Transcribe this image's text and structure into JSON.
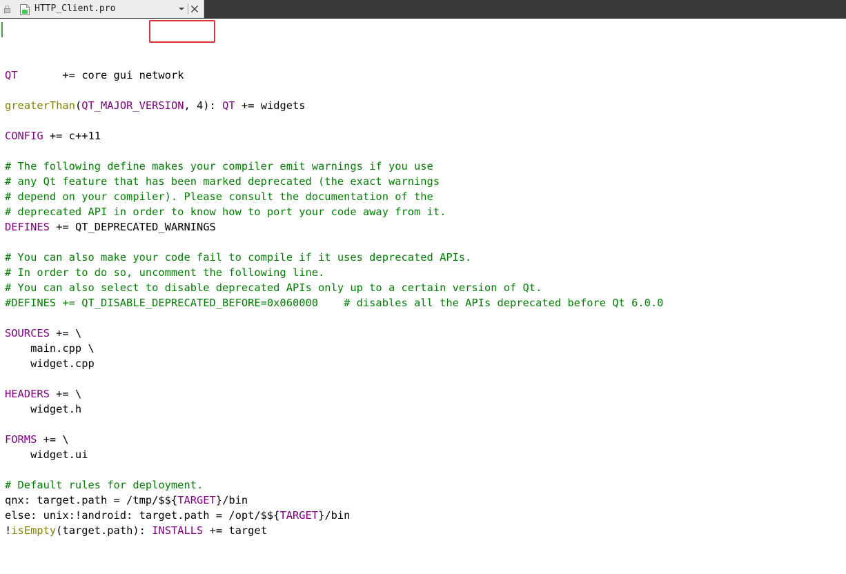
{
  "tab": {
    "title": "HTTP_Client.pro",
    "file_icon": "qt-project-file-icon",
    "lock_icon": "lock-icon",
    "dropdown_icon": "chevron-down-icon",
    "close_icon": "close-icon"
  },
  "colors": {
    "keyword": "#800080",
    "function": "#808000",
    "comment": "#008000",
    "highlight_box": "#e03030",
    "tabbar_bg": "#3a3a3a"
  },
  "editor": {
    "lines": [
      [
        {
          "t": "QT",
          "c": "kw"
        },
        {
          "t": "       += core gui ",
          "c": "pl"
        },
        {
          "t": "network",
          "c": "pl"
        }
      ],
      [],
      [
        {
          "t": "greaterThan",
          "c": "fn"
        },
        {
          "t": "(",
          "c": "pl"
        },
        {
          "t": "QT_MAJOR_VERSION",
          "c": "kw"
        },
        {
          "t": ", 4): ",
          "c": "pl"
        },
        {
          "t": "QT",
          "c": "kw"
        },
        {
          "t": " += widgets",
          "c": "pl"
        }
      ],
      [],
      [
        {
          "t": "CONFIG",
          "c": "kw"
        },
        {
          "t": " += c++11",
          "c": "pl"
        }
      ],
      [],
      [
        {
          "t": "# The following define makes your compiler emit warnings if you use",
          "c": "cm"
        }
      ],
      [
        {
          "t": "# any Qt feature that has been marked deprecated (the exact warnings",
          "c": "cm"
        }
      ],
      [
        {
          "t": "# depend on your compiler). Please consult the documentation of the",
          "c": "cm"
        }
      ],
      [
        {
          "t": "# deprecated API in order to know how to port your code away from it.",
          "c": "cm"
        }
      ],
      [
        {
          "t": "DEFINES",
          "c": "kw"
        },
        {
          "t": " += QT_DEPRECATED_WARNINGS",
          "c": "pl"
        }
      ],
      [],
      [
        {
          "t": "# You can also make your code fail to compile if it uses deprecated APIs.",
          "c": "cm"
        }
      ],
      [
        {
          "t": "# In order to do so, uncomment the following line.",
          "c": "cm"
        }
      ],
      [
        {
          "t": "# You can also select to disable deprecated APIs only up to a certain version of Qt.",
          "c": "cm"
        }
      ],
      [
        {
          "t": "#DEFINES += QT_DISABLE_DEPRECATED_BEFORE=0x060000    # disables all the APIs deprecated before Qt 6.0.0",
          "c": "cm"
        }
      ],
      [],
      [
        {
          "t": "SOURCES",
          "c": "kw"
        },
        {
          "t": " += \\",
          "c": "pl"
        }
      ],
      [
        {
          "t": "    main.cpp \\",
          "c": "pl"
        }
      ],
      [
        {
          "t": "    widget.cpp",
          "c": "pl"
        }
      ],
      [],
      [
        {
          "t": "HEADERS",
          "c": "kw"
        },
        {
          "t": " += \\",
          "c": "pl"
        }
      ],
      [
        {
          "t": "    widget.h",
          "c": "pl"
        }
      ],
      [],
      [
        {
          "t": "FORMS",
          "c": "kw"
        },
        {
          "t": " += \\",
          "c": "pl"
        }
      ],
      [
        {
          "t": "    widget.ui",
          "c": "pl"
        }
      ],
      [],
      [
        {
          "t": "# Default rules for deployment.",
          "c": "cm"
        }
      ],
      [
        {
          "t": "qnx: target.path = /tmp/$${",
          "c": "pl"
        },
        {
          "t": "TARGET",
          "c": "kw"
        },
        {
          "t": "}/bin",
          "c": "pl"
        }
      ],
      [
        {
          "t": "else: unix:!android: target.path = /opt/$${",
          "c": "pl"
        },
        {
          "t": "TARGET",
          "c": "kw"
        },
        {
          "t": "}/bin",
          "c": "pl"
        }
      ],
      [
        {
          "t": "!",
          "c": "pl"
        },
        {
          "t": "isEmpty",
          "c": "fn"
        },
        {
          "t": "(target.path): ",
          "c": "pl"
        },
        {
          "t": "INSTALLS",
          "c": "kw"
        },
        {
          "t": " += target",
          "c": "pl"
        }
      ]
    ]
  }
}
